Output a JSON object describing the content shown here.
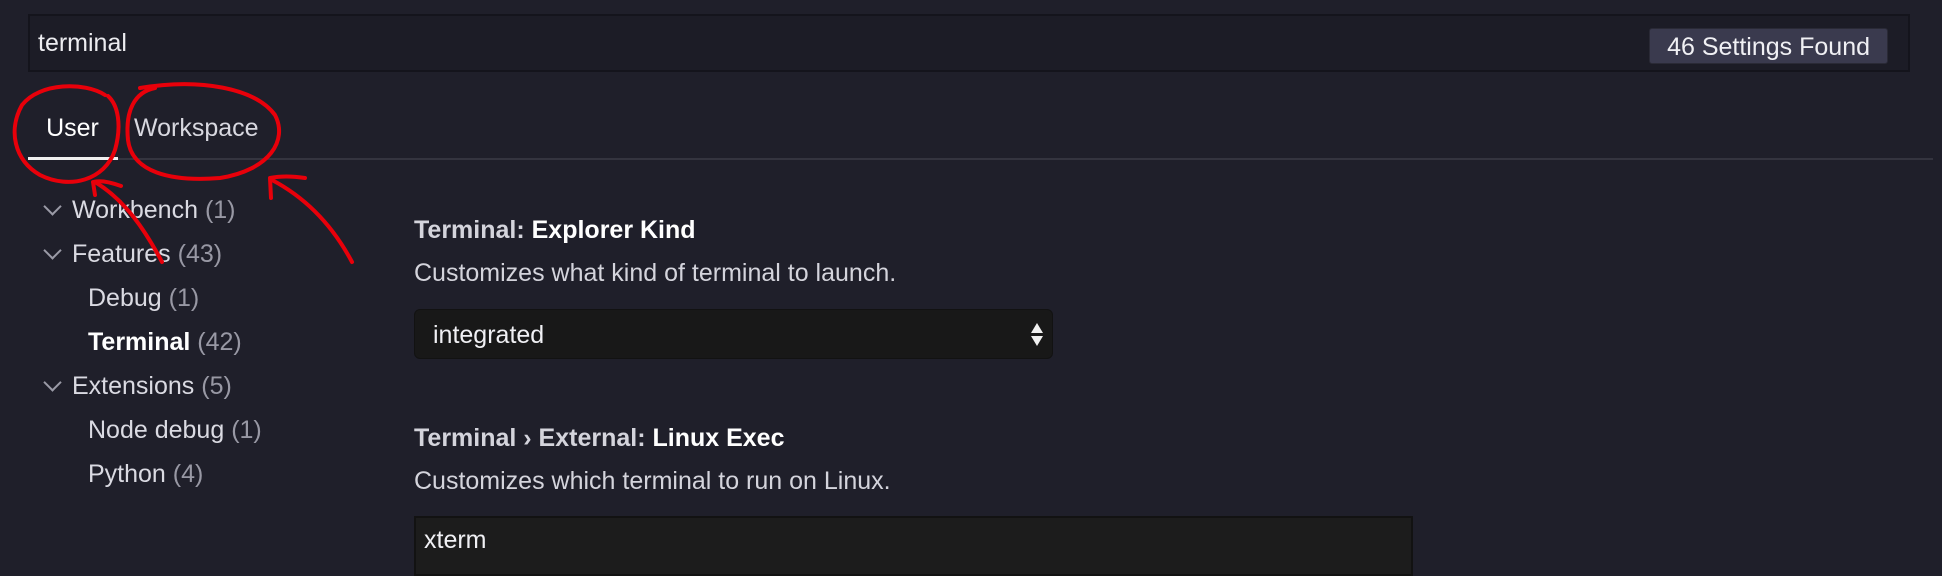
{
  "search": {
    "value": "terminal",
    "results_badge": "46 Settings Found"
  },
  "tabs": [
    {
      "label": "User",
      "active": true
    },
    {
      "label": "Workspace",
      "active": false
    }
  ],
  "toc": [
    {
      "label": "Workbench",
      "count": "(1)",
      "level": 0,
      "expanded": true
    },
    {
      "label": "Features",
      "count": "(43)",
      "level": 0,
      "expanded": true
    },
    {
      "label": "Debug",
      "count": "(1)",
      "level": 1
    },
    {
      "label": "Terminal",
      "count": "(42)",
      "level": 1,
      "selected": true
    },
    {
      "label": "Extensions",
      "count": "(5)",
      "level": 0,
      "expanded": true
    },
    {
      "label": "Node debug",
      "count": "(1)",
      "level": 1
    },
    {
      "label": "Python",
      "count": "(4)",
      "level": 1
    }
  ],
  "settings": [
    {
      "category": "Terminal: ",
      "key": "Explorer Kind",
      "description": "Customizes what kind of terminal to launch.",
      "control": "select",
      "value": "integrated"
    },
    {
      "category": "Terminal › External: ",
      "key": "Linux Exec",
      "description": "Customizes which terminal to run on Linux.",
      "control": "text",
      "value": "xterm"
    }
  ],
  "colors": {
    "background": "#1f1f2a",
    "annotation": "#e8000a"
  }
}
